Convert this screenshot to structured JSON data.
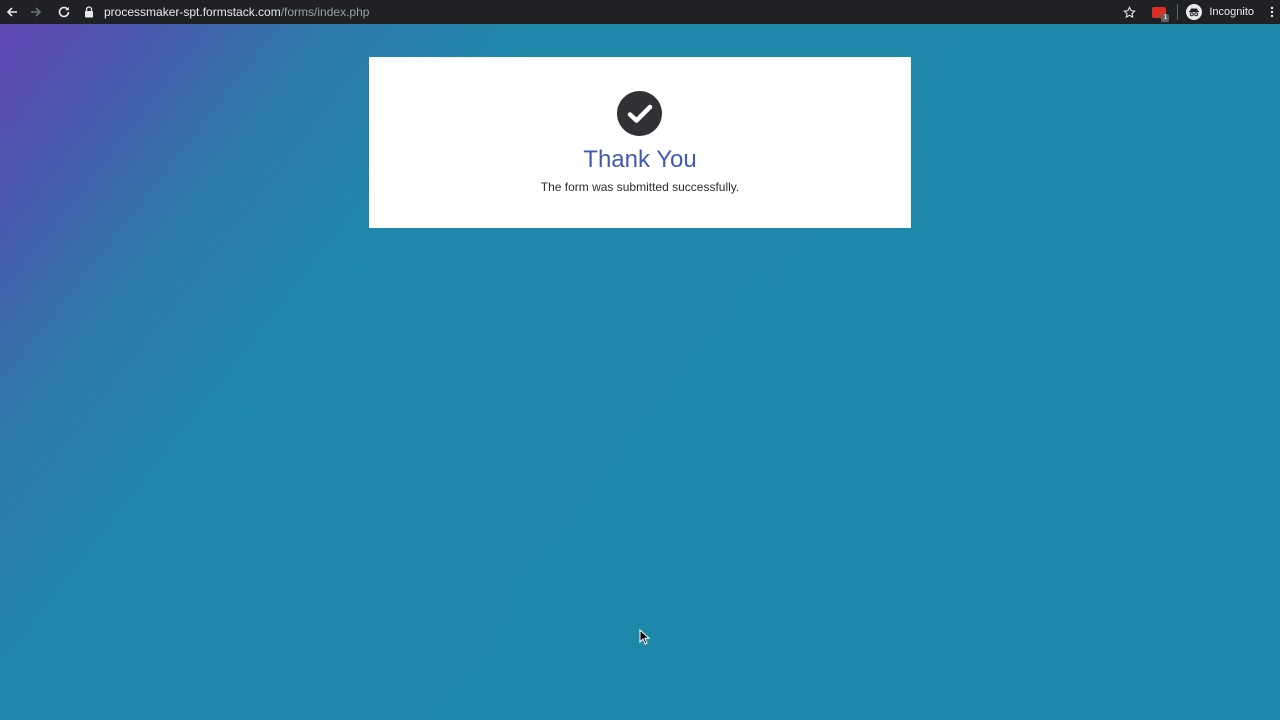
{
  "browser": {
    "url_host": "processmaker-spt.formstack.com",
    "url_path": "/forms/index.php",
    "profile_label": "Incognito",
    "extension_badge": "1"
  },
  "confirmation": {
    "title": "Thank You",
    "message": "The form was submitted successfully."
  },
  "colors": {
    "background": "#1e88ab",
    "gradient_corner": "#6247b4",
    "title": "#3f5bb5",
    "check_circle": "#303235"
  },
  "icons": {
    "back": "back-arrow-icon",
    "forward": "forward-arrow-icon",
    "reload": "reload-icon",
    "lock": "lock-icon",
    "bookmark": "star-icon",
    "extension": "extension-icon",
    "profile": "incognito-icon",
    "menu": "kebab-menu-icon",
    "success": "checkmark-icon"
  }
}
